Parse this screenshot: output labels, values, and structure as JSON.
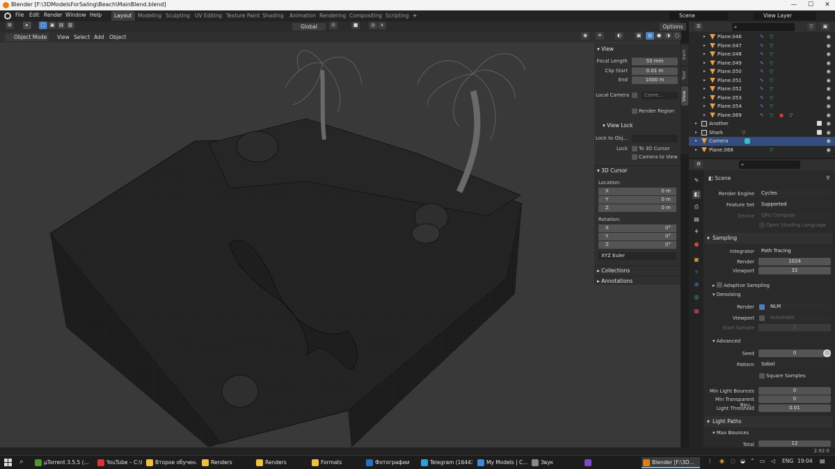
{
  "window": {
    "title": "Blender [F:\\3DModelsForSaling\\Beach\\MainBlend.blend]",
    "min": "—",
    "max": "☐",
    "close": "✕"
  },
  "menu": {
    "file": "File",
    "edit": "Edit",
    "render": "Render",
    "window": "Window",
    "help": "Help"
  },
  "workspaces": [
    "Layout",
    "Modeling",
    "Sculpting",
    "UV Editing",
    "Texture Paint",
    "Shading",
    "Animation",
    "Rendering",
    "Compositing",
    "Scripting",
    "+"
  ],
  "scene_field": "Scene",
  "viewlayer_field": "View Layer",
  "viewport": {
    "transform": "Global",
    "options": "Options",
    "mode": "Object Mode",
    "view": "View",
    "select": "Select",
    "add": "Add",
    "object": "Object"
  },
  "npanel": {
    "tabs": [
      "Item",
      "Tool",
      "View"
    ],
    "view_title": "View",
    "focal_label": "Focal Length",
    "focal_value": "50 mm",
    "clip_start_label": "Clip Start",
    "clip_start_value": "0.01 m",
    "end_label": "End",
    "end_value": "1000 m",
    "local_camera_label": "Local Camera",
    "local_camera_value": "Came...",
    "render_region": "Render Region",
    "view_lock_title": "View Lock",
    "lock_obj_label": "Lock to Obj...",
    "lock_label": "Lock",
    "to_3d_cursor": "To 3D Cursor",
    "camera_to_view": "Camera to View",
    "cursor_title": "3D Cursor",
    "location_label": "Location:",
    "rotation_label": "Rotation:",
    "loc": [
      {
        "k": "X",
        "v": "0 m"
      },
      {
        "k": "Y",
        "v": "0 m"
      },
      {
        "k": "Z",
        "v": "0 m"
      }
    ],
    "rot": [
      {
        "k": "X",
        "v": "0°"
      },
      {
        "k": "Y",
        "v": "0°"
      },
      {
        "k": "Z",
        "v": "0°"
      }
    ],
    "euler": "XYZ Euler",
    "collections": "Collections",
    "annotations": "Annotations"
  },
  "outliner": {
    "rows": [
      {
        "name": "Plane.046"
      },
      {
        "name": "Plane.047"
      },
      {
        "name": "Plane.048"
      },
      {
        "name": "Plane.049"
      },
      {
        "name": "Plane.050"
      },
      {
        "name": "Plane.051"
      },
      {
        "name": "Plane.052"
      },
      {
        "name": "Plane.053"
      },
      {
        "name": "Plane.054"
      },
      {
        "name": "Plane.069"
      },
      {
        "name": "Another"
      },
      {
        "name": "Shark"
      },
      {
        "name": "Camera"
      },
      {
        "name": "Plane.068"
      }
    ]
  },
  "props": {
    "scene": "Scene",
    "engine_label": "Render Engine",
    "engine_value": "Cycles",
    "feature_label": "Feature Set",
    "feature_value": "Supported",
    "device_label": "Device",
    "device_value": "GPU Compute",
    "osl": "Open Shading Language",
    "sampling": "Sampling",
    "integrator_label": "Integrator",
    "integrator_value": "Path Tracing",
    "render_label": "Render",
    "render_value": "1024",
    "viewport_label": "Viewport",
    "viewport_value": "32",
    "adaptive": "Adaptive Sampling",
    "denoising": "Denoising",
    "den_render_label": "Render",
    "den_render_value": "NLM",
    "den_viewport_label": "Viewport",
    "den_viewport_value": "Automatic",
    "start_sample_label": "Start Sample",
    "start_sample_value": "1",
    "advanced": "Advanced",
    "seed_label": "Seed",
    "seed_value": "0",
    "pattern_label": "Pattern",
    "pattern_value": "Sobol",
    "square": "Square Samples",
    "min_bounces_label": "Min Light Bounces",
    "min_bounces_value": "0",
    "min_trans_label": "Min Transparent Bou...",
    "min_trans_value": "0",
    "threshold_label": "Light Threshold",
    "threshold_value": "0.01",
    "light_paths": "Light Paths",
    "max_bounces": "Max Bounces",
    "total_label": "Total",
    "total_value": "12"
  },
  "version": "2.92.0",
  "taskbar": {
    "items": [
      {
        "label": "µTorrent 3.5.5  (..."
      },
      {
        "label": "YouTube – C:\\U..."
      },
      {
        "label": "Второе обучен..."
      },
      {
        "label": "Renders"
      },
      {
        "label": "Renders"
      },
      {
        "label": "Formats"
      },
      {
        "label": "Фотографии"
      },
      {
        "label": "Telegram (16443)"
      },
      {
        "label": "My Models | C..."
      },
      {
        "label": "Звук"
      },
      {
        "label": ""
      },
      {
        "label": "Blender [F:\\3D..."
      }
    ],
    "lang": "ENG",
    "time": "19:04"
  }
}
